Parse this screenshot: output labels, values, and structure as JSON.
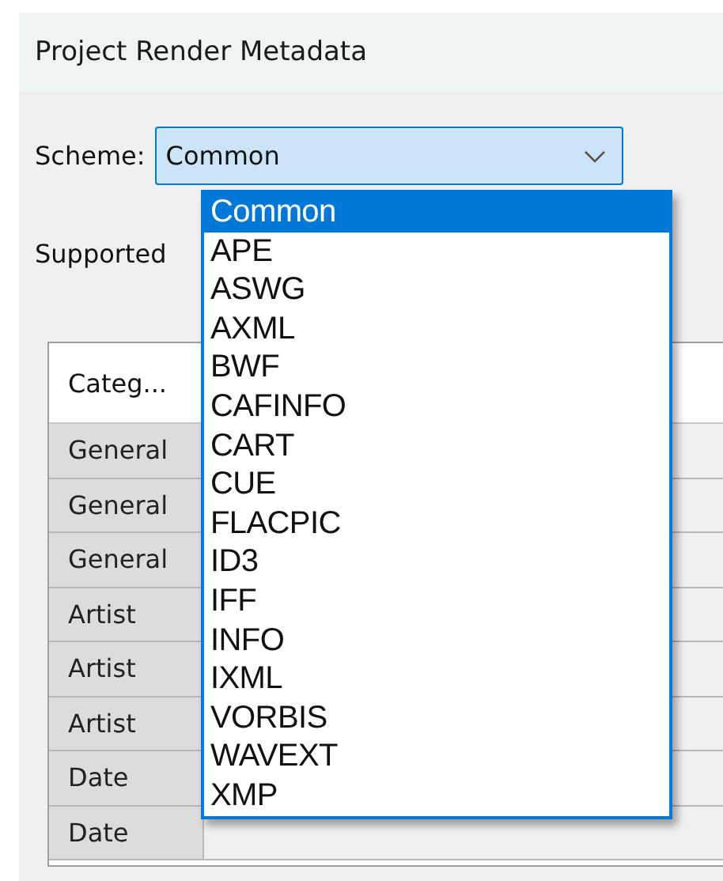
{
  "window": {
    "title": "Project Render Metadata"
  },
  "scheme": {
    "label": "Scheme:",
    "value": "Common",
    "expanded": true,
    "options": [
      {
        "label": "Common",
        "selected": true
      },
      {
        "label": "APE",
        "selected": false
      },
      {
        "label": "ASWG",
        "selected": false
      },
      {
        "label": "AXML",
        "selected": false
      },
      {
        "label": "BWF",
        "selected": false
      },
      {
        "label": "CAFINFO",
        "selected": false
      },
      {
        "label": "CART",
        "selected": false
      },
      {
        "label": "CUE",
        "selected": false
      },
      {
        "label": "FLACPIC",
        "selected": false
      },
      {
        "label": "ID3",
        "selected": false
      },
      {
        "label": "IFF",
        "selected": false
      },
      {
        "label": "INFO",
        "selected": false
      },
      {
        "label": "IXML",
        "selected": false
      },
      {
        "label": "VORBIS",
        "selected": false
      },
      {
        "label": "WAVEXT",
        "selected": false
      },
      {
        "label": "XMP",
        "selected": false
      }
    ]
  },
  "supported_label": "Supported",
  "table": {
    "columns": [
      "Categ..."
    ],
    "rows": [
      [
        "General"
      ],
      [
        "General"
      ],
      [
        "General"
      ],
      [
        "Artist"
      ],
      [
        "Artist"
      ],
      [
        "Artist"
      ],
      [
        "Date"
      ],
      [
        "Date"
      ]
    ]
  }
}
